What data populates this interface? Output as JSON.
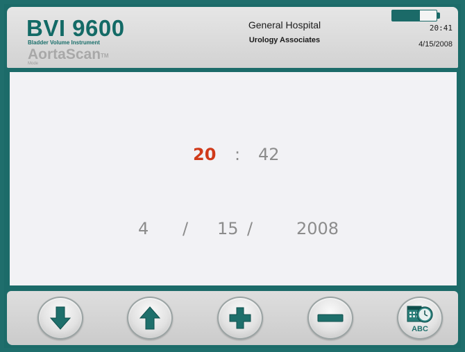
{
  "header": {
    "brand_model": "BVI 9600",
    "brand_subtitle": "Bladder Volume Instrument",
    "brand_product": "AortaScan",
    "brand_trademark": "TM",
    "brand_mode": "Mode",
    "facility": "General Hospital",
    "department": "Urology Associates",
    "time": "20:41",
    "date": "4/15/2008",
    "battery_level": 0.62
  },
  "editor": {
    "hour": "20",
    "time_separator": ":",
    "minute": "42",
    "month": "4",
    "date_separator_1": "/",
    "day": "15",
    "date_separator_2": "/",
    "year": "2008"
  },
  "toolbar": {
    "buttons": [
      {
        "name": "down",
        "icon": "arrow-down-icon"
      },
      {
        "name": "up",
        "icon": "arrow-up-icon"
      },
      {
        "name": "increment",
        "icon": "plus-icon"
      },
      {
        "name": "decrement",
        "icon": "minus-icon"
      },
      {
        "name": "clock-settings",
        "icon": "calendar-clock-abc-icon",
        "label": "ABC"
      }
    ]
  },
  "colors": {
    "frame": "#1f6e6c",
    "accent": "#1b6a68",
    "selected": "#d03a1a",
    "value_text": "#8c8c8c"
  }
}
